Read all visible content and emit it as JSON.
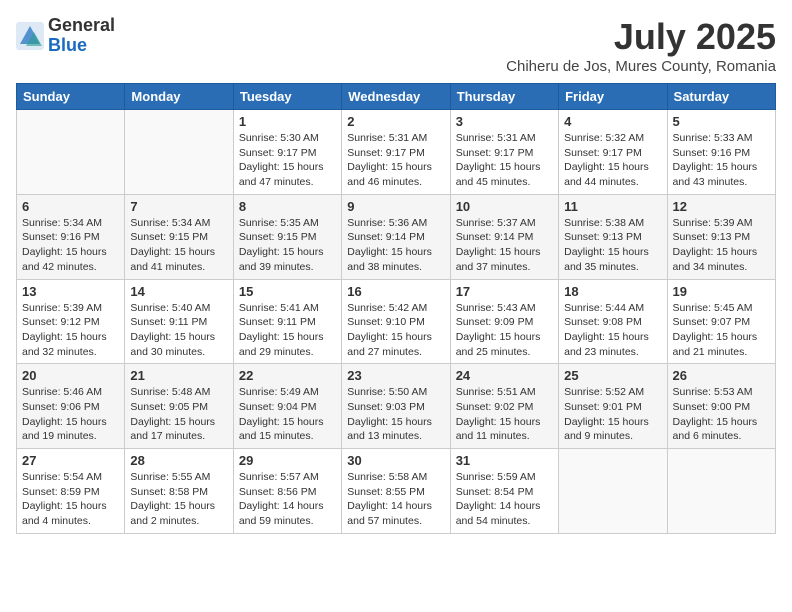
{
  "logo": {
    "general": "General",
    "blue": "Blue"
  },
  "title": "July 2025",
  "subtitle": "Chiheru de Jos, Mures County, Romania",
  "headers": [
    "Sunday",
    "Monday",
    "Tuesday",
    "Wednesday",
    "Thursday",
    "Friday",
    "Saturday"
  ],
  "weeks": [
    [
      {
        "day": "",
        "info": ""
      },
      {
        "day": "",
        "info": ""
      },
      {
        "day": "1",
        "info": "Sunrise: 5:30 AM\nSunset: 9:17 PM\nDaylight: 15 hours and 47 minutes."
      },
      {
        "day": "2",
        "info": "Sunrise: 5:31 AM\nSunset: 9:17 PM\nDaylight: 15 hours and 46 minutes."
      },
      {
        "day": "3",
        "info": "Sunrise: 5:31 AM\nSunset: 9:17 PM\nDaylight: 15 hours and 45 minutes."
      },
      {
        "day": "4",
        "info": "Sunrise: 5:32 AM\nSunset: 9:17 PM\nDaylight: 15 hours and 44 minutes."
      },
      {
        "day": "5",
        "info": "Sunrise: 5:33 AM\nSunset: 9:16 PM\nDaylight: 15 hours and 43 minutes."
      }
    ],
    [
      {
        "day": "6",
        "info": "Sunrise: 5:34 AM\nSunset: 9:16 PM\nDaylight: 15 hours and 42 minutes."
      },
      {
        "day": "7",
        "info": "Sunrise: 5:34 AM\nSunset: 9:15 PM\nDaylight: 15 hours and 41 minutes."
      },
      {
        "day": "8",
        "info": "Sunrise: 5:35 AM\nSunset: 9:15 PM\nDaylight: 15 hours and 39 minutes."
      },
      {
        "day": "9",
        "info": "Sunrise: 5:36 AM\nSunset: 9:14 PM\nDaylight: 15 hours and 38 minutes."
      },
      {
        "day": "10",
        "info": "Sunrise: 5:37 AM\nSunset: 9:14 PM\nDaylight: 15 hours and 37 minutes."
      },
      {
        "day": "11",
        "info": "Sunrise: 5:38 AM\nSunset: 9:13 PM\nDaylight: 15 hours and 35 minutes."
      },
      {
        "day": "12",
        "info": "Sunrise: 5:39 AM\nSunset: 9:13 PM\nDaylight: 15 hours and 34 minutes."
      }
    ],
    [
      {
        "day": "13",
        "info": "Sunrise: 5:39 AM\nSunset: 9:12 PM\nDaylight: 15 hours and 32 minutes."
      },
      {
        "day": "14",
        "info": "Sunrise: 5:40 AM\nSunset: 9:11 PM\nDaylight: 15 hours and 30 minutes."
      },
      {
        "day": "15",
        "info": "Sunrise: 5:41 AM\nSunset: 9:11 PM\nDaylight: 15 hours and 29 minutes."
      },
      {
        "day": "16",
        "info": "Sunrise: 5:42 AM\nSunset: 9:10 PM\nDaylight: 15 hours and 27 minutes."
      },
      {
        "day": "17",
        "info": "Sunrise: 5:43 AM\nSunset: 9:09 PM\nDaylight: 15 hours and 25 minutes."
      },
      {
        "day": "18",
        "info": "Sunrise: 5:44 AM\nSunset: 9:08 PM\nDaylight: 15 hours and 23 minutes."
      },
      {
        "day": "19",
        "info": "Sunrise: 5:45 AM\nSunset: 9:07 PM\nDaylight: 15 hours and 21 minutes."
      }
    ],
    [
      {
        "day": "20",
        "info": "Sunrise: 5:46 AM\nSunset: 9:06 PM\nDaylight: 15 hours and 19 minutes."
      },
      {
        "day": "21",
        "info": "Sunrise: 5:48 AM\nSunset: 9:05 PM\nDaylight: 15 hours and 17 minutes."
      },
      {
        "day": "22",
        "info": "Sunrise: 5:49 AM\nSunset: 9:04 PM\nDaylight: 15 hours and 15 minutes."
      },
      {
        "day": "23",
        "info": "Sunrise: 5:50 AM\nSunset: 9:03 PM\nDaylight: 15 hours and 13 minutes."
      },
      {
        "day": "24",
        "info": "Sunrise: 5:51 AM\nSunset: 9:02 PM\nDaylight: 15 hours and 11 minutes."
      },
      {
        "day": "25",
        "info": "Sunrise: 5:52 AM\nSunset: 9:01 PM\nDaylight: 15 hours and 9 minutes."
      },
      {
        "day": "26",
        "info": "Sunrise: 5:53 AM\nSunset: 9:00 PM\nDaylight: 15 hours and 6 minutes."
      }
    ],
    [
      {
        "day": "27",
        "info": "Sunrise: 5:54 AM\nSunset: 8:59 PM\nDaylight: 15 hours and 4 minutes."
      },
      {
        "day": "28",
        "info": "Sunrise: 5:55 AM\nSunset: 8:58 PM\nDaylight: 15 hours and 2 minutes."
      },
      {
        "day": "29",
        "info": "Sunrise: 5:57 AM\nSunset: 8:56 PM\nDaylight: 14 hours and 59 minutes."
      },
      {
        "day": "30",
        "info": "Sunrise: 5:58 AM\nSunset: 8:55 PM\nDaylight: 14 hours and 57 minutes."
      },
      {
        "day": "31",
        "info": "Sunrise: 5:59 AM\nSunset: 8:54 PM\nDaylight: 14 hours and 54 minutes."
      },
      {
        "day": "",
        "info": ""
      },
      {
        "day": "",
        "info": ""
      }
    ]
  ]
}
